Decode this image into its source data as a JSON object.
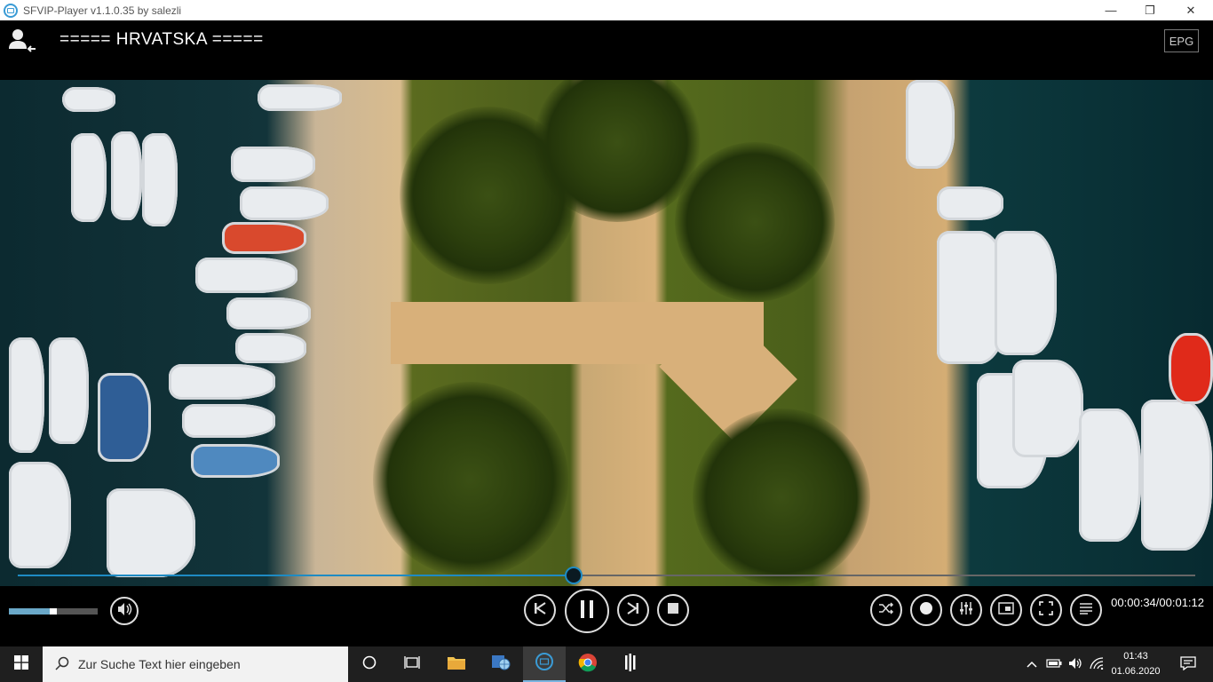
{
  "window": {
    "title": "SFVIP-Player v1.1.0.35 by salezli",
    "minimize": "—",
    "maximize": "❐",
    "close": "✕"
  },
  "header": {
    "channel_name": "===== HRVATSKA =====",
    "epg_label": "EPG"
  },
  "playback": {
    "progress_fraction": 0.472,
    "volume_fraction": 0.5,
    "time_display": "00:00:34/00:01:12"
  },
  "controls": {
    "icons": [
      "volume-icon",
      "previous-icon",
      "pause-icon",
      "next-icon",
      "stop-icon",
      "shuffle-icon",
      "record-icon",
      "equalizer-icon",
      "picture-in-picture-icon",
      "fullscreen-icon",
      "menu-icon"
    ]
  },
  "taskbar": {
    "search_placeholder": "Zur Suche Text hier eingeben",
    "clock_time": "01:43",
    "clock_date": "01.06.2020"
  },
  "colors": {
    "accent": "#1e8bc3",
    "background": "#000000",
    "taskbar": "#1f1f1f"
  }
}
